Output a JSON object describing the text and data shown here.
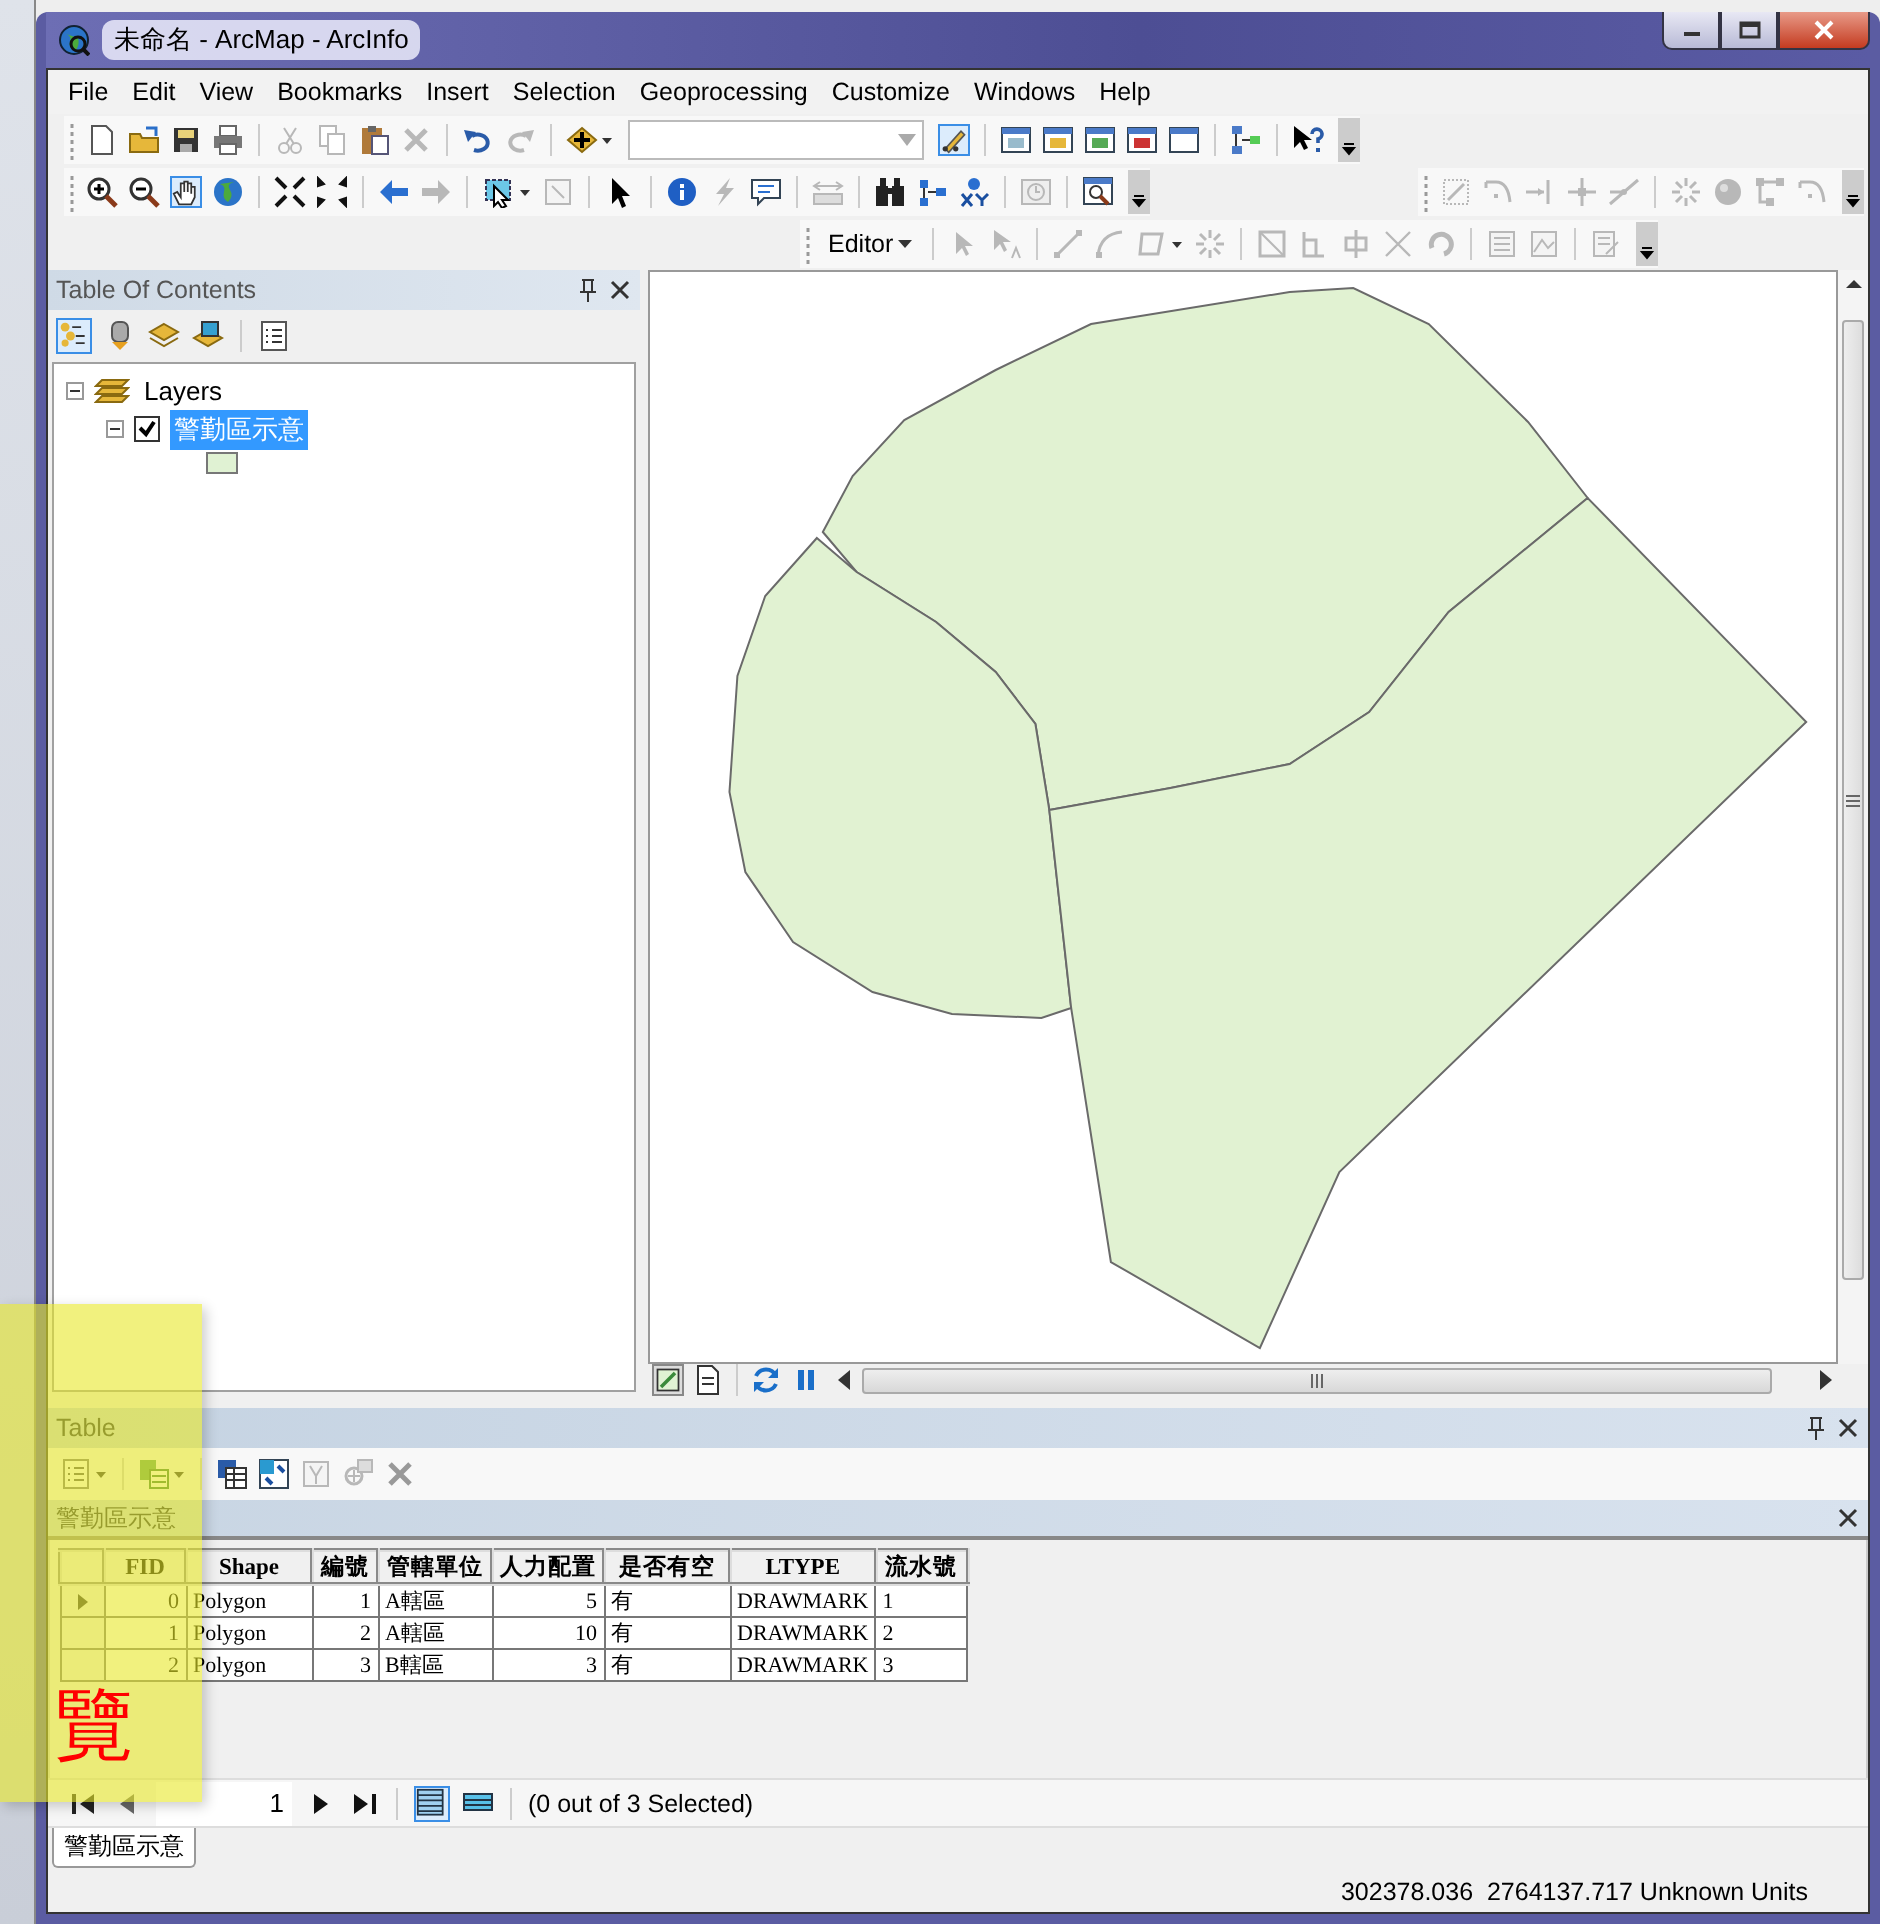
{
  "window": {
    "title": "未命名 - ArcMap - ArcInfo"
  },
  "menu": [
    "File",
    "Edit",
    "View",
    "Bookmarks",
    "Insert",
    "Selection",
    "Geoprocessing",
    "Customize",
    "Windows",
    "Help"
  ],
  "editor_toolbar": {
    "label": "Editor"
  },
  "toc": {
    "title": "Table Of Contents",
    "tree": [
      {
        "name": "Layers",
        "kind": "frame",
        "expanded": true,
        "children": [
          {
            "name": "警勤區示意",
            "kind": "layer",
            "expanded": true,
            "checked": true,
            "selected": true
          }
        ]
      }
    ]
  },
  "table": {
    "title": "Table",
    "layer_title": "警勤區示意",
    "columns": [
      {
        "label": "FID",
        "kind": "number"
      },
      {
        "label": "Shape",
        "kind": "text"
      },
      {
        "label": "編號",
        "kind": "number"
      },
      {
        "label": "管轄單位",
        "kind": "text"
      },
      {
        "label": "人力配置",
        "kind": "number"
      },
      {
        "label": "是否有空",
        "kind": "text"
      },
      {
        "label": "LTYPE",
        "kind": "text"
      },
      {
        "label": "流水號",
        "kind": "text"
      }
    ],
    "rows": [
      {
        "current": true,
        "cells": [
          "0",
          "Polygon",
          "1",
          "A轄區",
          "5",
          "有",
          "DRAWMARK",
          "1"
        ]
      },
      {
        "current": false,
        "cells": [
          "1",
          "Polygon",
          "2",
          "A轄區",
          "10",
          "有",
          "DRAWMARK",
          "2"
        ]
      },
      {
        "current": false,
        "cells": [
          "2",
          "Polygon",
          "3",
          "B轄區",
          "3",
          "有",
          "DRAWMARK",
          "3"
        ]
      }
    ],
    "record": "1",
    "selection_status": "(0 out of 3 Selected)",
    "tabs": [
      {
        "label": "警勤區示意",
        "selected": true
      }
    ]
  },
  "status_bar": {
    "coordinates": "302378.036  2764137.717 Unknown Units"
  },
  "note": {
    "text": "覽"
  }
}
